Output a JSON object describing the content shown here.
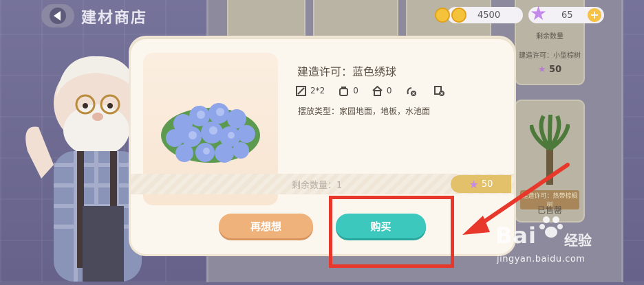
{
  "header": {
    "title": "建材商店",
    "back_icon": "back-arrow-icon"
  },
  "currency": {
    "gold_value": "4500",
    "gem_value": "65",
    "plus_label": "+"
  },
  "background_cards": {
    "remaining_label": "剩余数量",
    "cert_label": "建造许可：小型棕树",
    "price": "50",
    "sub_label": "建造许可：热带棕榈树",
    "sold_label": "已售罄"
  },
  "dialog": {
    "title": "建造许可：蓝色绣球",
    "attrs": [
      {
        "icon": "size-icon",
        "value": "2*2"
      },
      {
        "icon": "bag-icon",
        "value": "0"
      },
      {
        "icon": "home-icon",
        "value": "0"
      },
      {
        "icon": "no-rotate-icon",
        "value": ""
      },
      {
        "icon": "no-copy-icon",
        "value": ""
      }
    ],
    "placement": "摆放类型：家园地面，地板，水池面",
    "remaining": "剩余数量：1",
    "price": "50",
    "rethink_label": "再想想",
    "buy_label": "购买"
  },
  "watermark": {
    "brand": "Bai",
    "brand_cn": "经验",
    "url": "jingyan.baidu.com"
  },
  "colors": {
    "accent_teal": "#3dc8bd",
    "accent_orange": "#f0b27b",
    "highlight_red": "#e8382b",
    "star_purple": "#c389e8"
  }
}
